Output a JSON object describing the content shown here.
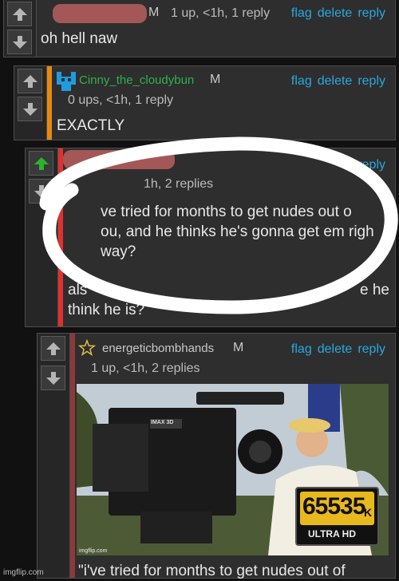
{
  "comments": [
    {
      "username": "",
      "badge": "M",
      "meta": "1 up, <1h, 1 reply",
      "text": "oh hell naw",
      "actions": [
        "flag",
        "delete",
        "reply"
      ]
    },
    {
      "username": "Cinny_the_cloudybun",
      "badge": "M",
      "meta": "0 ups, <1h, 1 reply",
      "text": "EXACTLY",
      "actions": [
        "flag",
        "delete",
        "reply"
      ],
      "bar_color": "#e58a0e",
      "avatar_color": "#1f9ce0"
    },
    {
      "username": "",
      "meta_fragment": "1h, 2 replies",
      "action_fragment": "te reply",
      "text_fragments": [
        "ve tried for months to get nudes out o",
        "ou, and he thinks he's gonna get em righ",
        "way?",
        "als",
        "e he",
        "think he is?"
      ],
      "bar_color": "#e03030"
    },
    {
      "username": "energeticbombhands",
      "badge": "M",
      "meta": "1 up, <1h, 2 replies",
      "actions": [
        "flag",
        "delete",
        "reply"
      ],
      "bar_color": "#8b3a3a",
      "image": {
        "logo_number": "65535",
        "logo_suffix": "K",
        "logo_caption": "ULTRA HD",
        "camera_label": "IMAX 3D",
        "watermark": "imgflip.com"
      },
      "caption_text": "\"i've tried for months to get nudes out of"
    }
  ],
  "footer_watermark": "imgflip.com",
  "colors": {
    "link": "#29a8e0",
    "upvote_active": "#2db22d",
    "vote_icon": "#b5b5b5"
  }
}
